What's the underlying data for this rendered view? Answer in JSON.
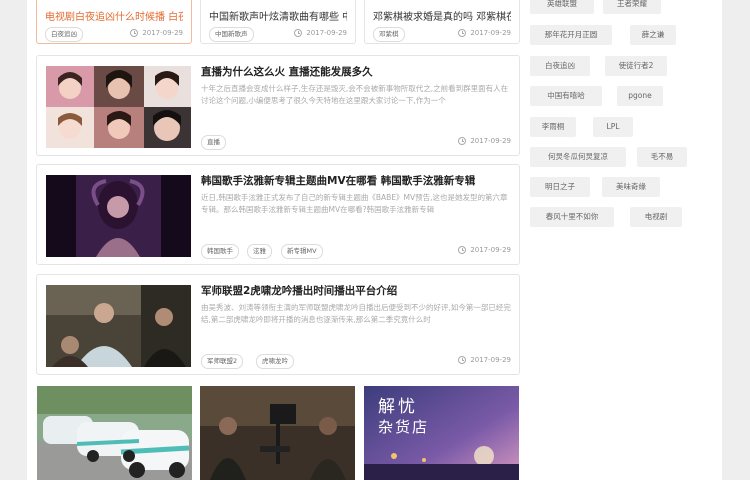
{
  "top_cards": [
    {
      "title": "电视剧白夜追凶什么时候播 白夜",
      "tag": "白夜追凶",
      "date": "2017-09-29",
      "highlight": true
    },
    {
      "title": "中国新歌声叶炫清歌曲有哪些 中",
      "tag": "中国新歌声",
      "date": "2017-09-29",
      "highlight": false
    },
    {
      "title": "邓紫棋被求婚是真的吗 邓紫棋在",
      "tag": "邓紫棋",
      "date": "2017-09-29",
      "highlight": false
    }
  ],
  "articles": [
    {
      "title": "直播为什么这么火 直播还能发展多久",
      "desc": "十年之后直播会变成什么样子,生存还是毁灭,会不会被新事物所取代之,之前看到群里面有人在讨论这个问题,小编便思考了很久今天特地在这里跟大家讨论一下,作为一个",
      "tags": [
        "直播"
      ],
      "date": "2017-09-29"
    },
    {
      "title": "韩国歌手泫雅新专辑主题曲MV在哪看 韩国歌手泫雅新专辑",
      "desc": "近日,韩国歌手泫雅正式发布了自己的新专辑主题曲《BABE》MV预告,这也是她发型的第六章专辑。那么韩国歌手泫雅新专辑主题曲MV在哪看?韩国歌手泫雅新专辑",
      "tags": [
        "韩国歌手",
        "泫雅",
        "新专辑MV"
      ],
      "date": "2017-09-29"
    },
    {
      "title": "军师联盟2虎啸龙吟播出时间播出平台介绍",
      "desc": "由吴秀波、刘涛等领衔主演的军师联盟虎啸龙吟自播出后便受到不少的好评,如今第一部已经完结,第二部虎啸龙吟即将开播的消息也逐渐传来,那么第二季究竟什么时",
      "tags": [
        "军师联盟2",
        "虎啸龙吟"
      ],
      "date": "2017-09-29"
    }
  ],
  "bottom_images": [
    "cars-photo",
    "film-set-photo",
    "jieyou-poster"
  ],
  "poster_text": [
    "解忧",
    "杂货店"
  ],
  "sidebar_tags": [
    "英雄联盟",
    "王者荣耀",
    "那年花开月正圆",
    "薛之谦",
    "白夜追凶",
    "使徒行者2",
    "中国有嘻哈",
    "pgone",
    "李雨桐",
    "LPL",
    "何炅冬瓜何炅复凉",
    "毛不易",
    "明日之子",
    "美味奇缘",
    "春风十里不如你",
    "电视剧"
  ]
}
